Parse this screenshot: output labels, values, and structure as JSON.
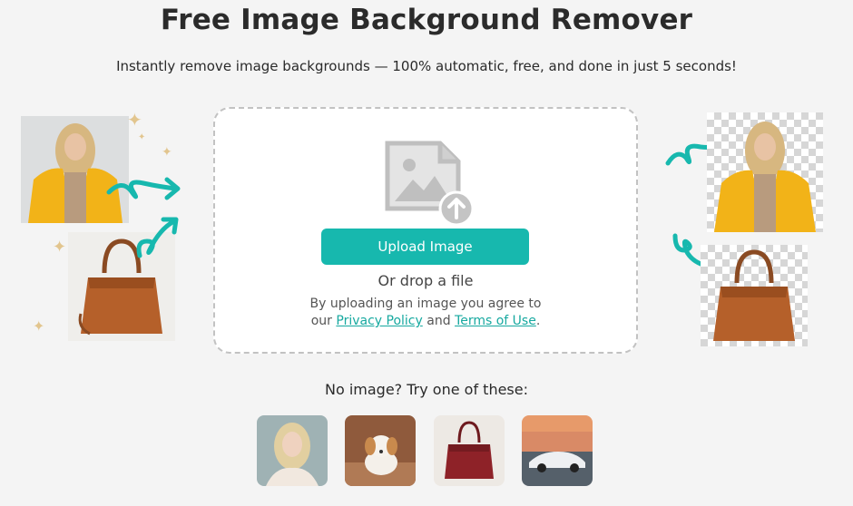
{
  "header": {
    "title": "Free Image Background Remover",
    "subtitle": "Instantly remove image backgrounds — 100% automatic, free, and done in just 5 seconds!"
  },
  "upload": {
    "button_label": "Upload Image",
    "drop_text": "Or drop a file",
    "agree_prefix": "By uploading an image you agree to",
    "agree_our": "our",
    "privacy_link": "Privacy Policy",
    "and": "and",
    "terms_link": "Terms of Use",
    "period": "."
  },
  "samples": {
    "prompt": "No image? Try one of these:",
    "items": [
      {
        "name": "sample-woman"
      },
      {
        "name": "sample-puppy"
      },
      {
        "name": "sample-handbag"
      },
      {
        "name": "sample-car"
      }
    ]
  },
  "colors": {
    "accent": "#17b8ae",
    "link": "#17a9a0",
    "background": "#f4f4f4",
    "jacket_yellow": "#f2b318",
    "bag_brown": "#b5602a"
  }
}
